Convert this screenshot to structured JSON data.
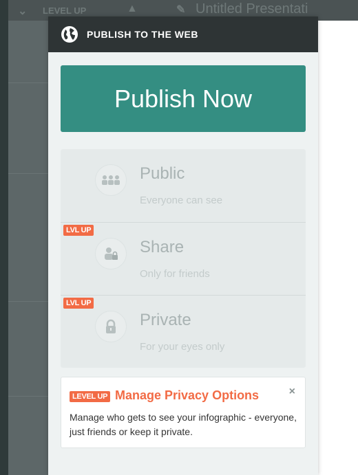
{
  "background": {
    "topbar": {
      "badge": "LEVEL UP",
      "title": "Untitled Presentati"
    }
  },
  "panel": {
    "header": {
      "icon": "globe-icon",
      "title": "PUBLISH TO THE WEB"
    },
    "publish_button": "Publish Now",
    "options": [
      {
        "label": "Public",
        "sub": "Everyone can see",
        "icon": "people-icon",
        "badge": ""
      },
      {
        "label": "Share",
        "sub": "Only for friends",
        "icon": "person-lock-icon",
        "badge": "LVL UP"
      },
      {
        "label": "Private",
        "sub": "For your eyes only",
        "icon": "lock-icon",
        "badge": "LVL UP"
      }
    ],
    "privacy_notice": {
      "badge": "LEVEL UP",
      "title": "Manage Privacy Options",
      "close": "×",
      "description": "Manage who gets to see your infographic - everyone, just friends or keep it private."
    }
  },
  "colors": {
    "accent_teal": "#348e82",
    "level_up_orange": "#f26b45",
    "header_dark": "#2e3435"
  }
}
